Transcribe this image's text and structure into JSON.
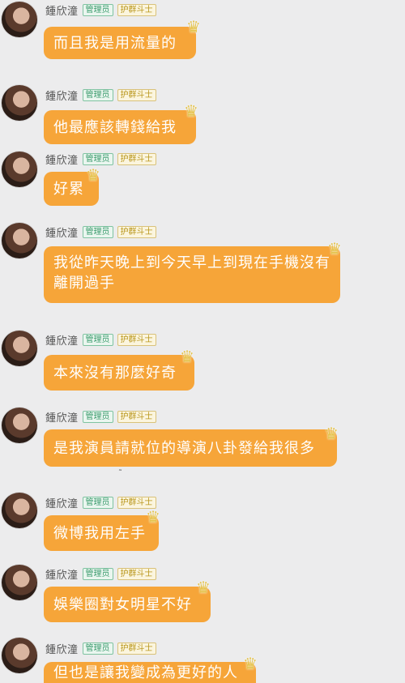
{
  "user": {
    "name": "鍾欣潼",
    "badge_admin": "管理员",
    "badge_guard": "护群斗士"
  },
  "messages": [
    {
      "text": "而且我是用流量的"
    },
    {
      "text": "他最應該轉錢給我"
    },
    {
      "text": "好累"
    },
    {
      "text": "我從昨天晚上到今天早上到現在手機沒有離開過手"
    },
    {
      "text": "本來沒有那麼好奇"
    },
    {
      "text": "是我演員請就位的導演八卦發給我很多"
    },
    {
      "text": "微博我用左手"
    },
    {
      "text": "娛樂圈對女明星不好"
    },
    {
      "text": "但也是讓我變成為更好的人"
    }
  ],
  "icons": {
    "avatar": "profile-photo",
    "crown": "crown-icon"
  },
  "colors": {
    "bubble": "#f6a539",
    "background": "#ececed",
    "admin_badge": "#3b9b6d",
    "guard_badge": "#b9961c"
  }
}
